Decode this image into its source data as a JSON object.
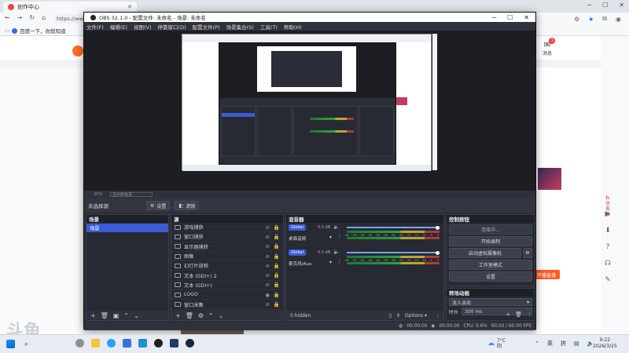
{
  "browser": {
    "tab_title": "创作中心",
    "url": "https://ww",
    "bookmark": "百度一下，你就知道",
    "right_icon_label": "消息",
    "badge_count": "1"
  },
  "page_behind": {
    "right_texts": [
      "私信客服",
      "开播直播"
    ]
  },
  "obs": {
    "title": "OBS 32.1.0 - 配置文件: 未命名 - 场景: 未命名",
    "menu": [
      "文件(F)",
      "编辑(E)",
      "视图(V)",
      "停靠窗口(D)",
      "配置文件(P)",
      "场景集合(S)",
      "工具(T)",
      "帮助(H)"
    ],
    "context_bar": [
      "25%",
      "显示所有源"
    ],
    "source_toolbar": {
      "no_source": "未选择源",
      "properties": "设置",
      "filters": "滤镜"
    },
    "scenes": {
      "title": "场景",
      "items": [
        "场景"
      ]
    },
    "sources": {
      "title": "源",
      "items": [
        "游戏捕获",
        "窗口捕获",
        "显示器捕获",
        "图像",
        "幻灯片放映",
        "文本 (GDI+) 2",
        "文本 (GDI+)",
        "LOGO",
        "窗口采集",
        "游戏采集"
      ]
    },
    "mixer": {
      "title": "混音器",
      "channels": [
        {
          "tag": "Global",
          "name": "桌面音频",
          "db": "0.0 dB"
        },
        {
          "tag": "Global",
          "name": "麦克风/Aux",
          "db": "0.0 dB"
        }
      ],
      "scale": [
        "-60",
        "-55",
        "-50",
        "-45",
        "-40",
        "-35",
        "-30",
        "-25",
        "-20",
        "-15",
        "-10",
        "-5",
        "0"
      ],
      "footer_left": "0 hidden",
      "options": "Options"
    },
    "controls": {
      "title": "控制按钮",
      "items": [
        "连接中...",
        "开始录制",
        "启动虚拟摄像机",
        "工作室模式",
        "设置"
      ]
    },
    "transitions": {
      "title": "转场动画",
      "type": "淡入淡出",
      "duration_label": "时长",
      "duration_value": "300 ms"
    },
    "status": {
      "t1": "00:00:00",
      "t2": "00:00:00",
      "cpu": "CPU: 0.6%",
      "fps": "60.00 / 60.00 FPS"
    }
  },
  "taskbar": {
    "weather": "7°C",
    "weather_sub": "阴",
    "ime": [
      "英",
      "拼"
    ],
    "time": "9:22",
    "date": "2026/3/25"
  },
  "watermark": "斗鱼"
}
